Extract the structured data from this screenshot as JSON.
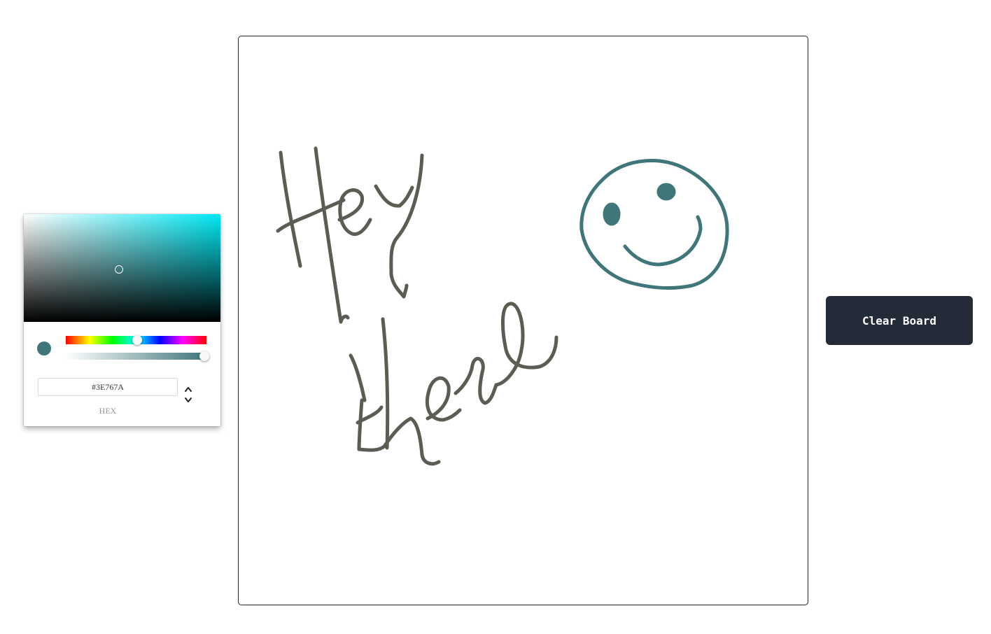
{
  "color_picker": {
    "hex_value": "#3E767A",
    "mode_label": "HEX",
    "selected_color": "#3E767A",
    "hue_color": "#00E8F4",
    "mode_toggle_icon": "chevron-up-down-icon"
  },
  "board": {
    "pen_color_text": "#5B5C52",
    "pen_color_smiley": "#3E767A",
    "background": "#FFFFFF"
  },
  "actions": {
    "clear_label": "Clear Board"
  }
}
